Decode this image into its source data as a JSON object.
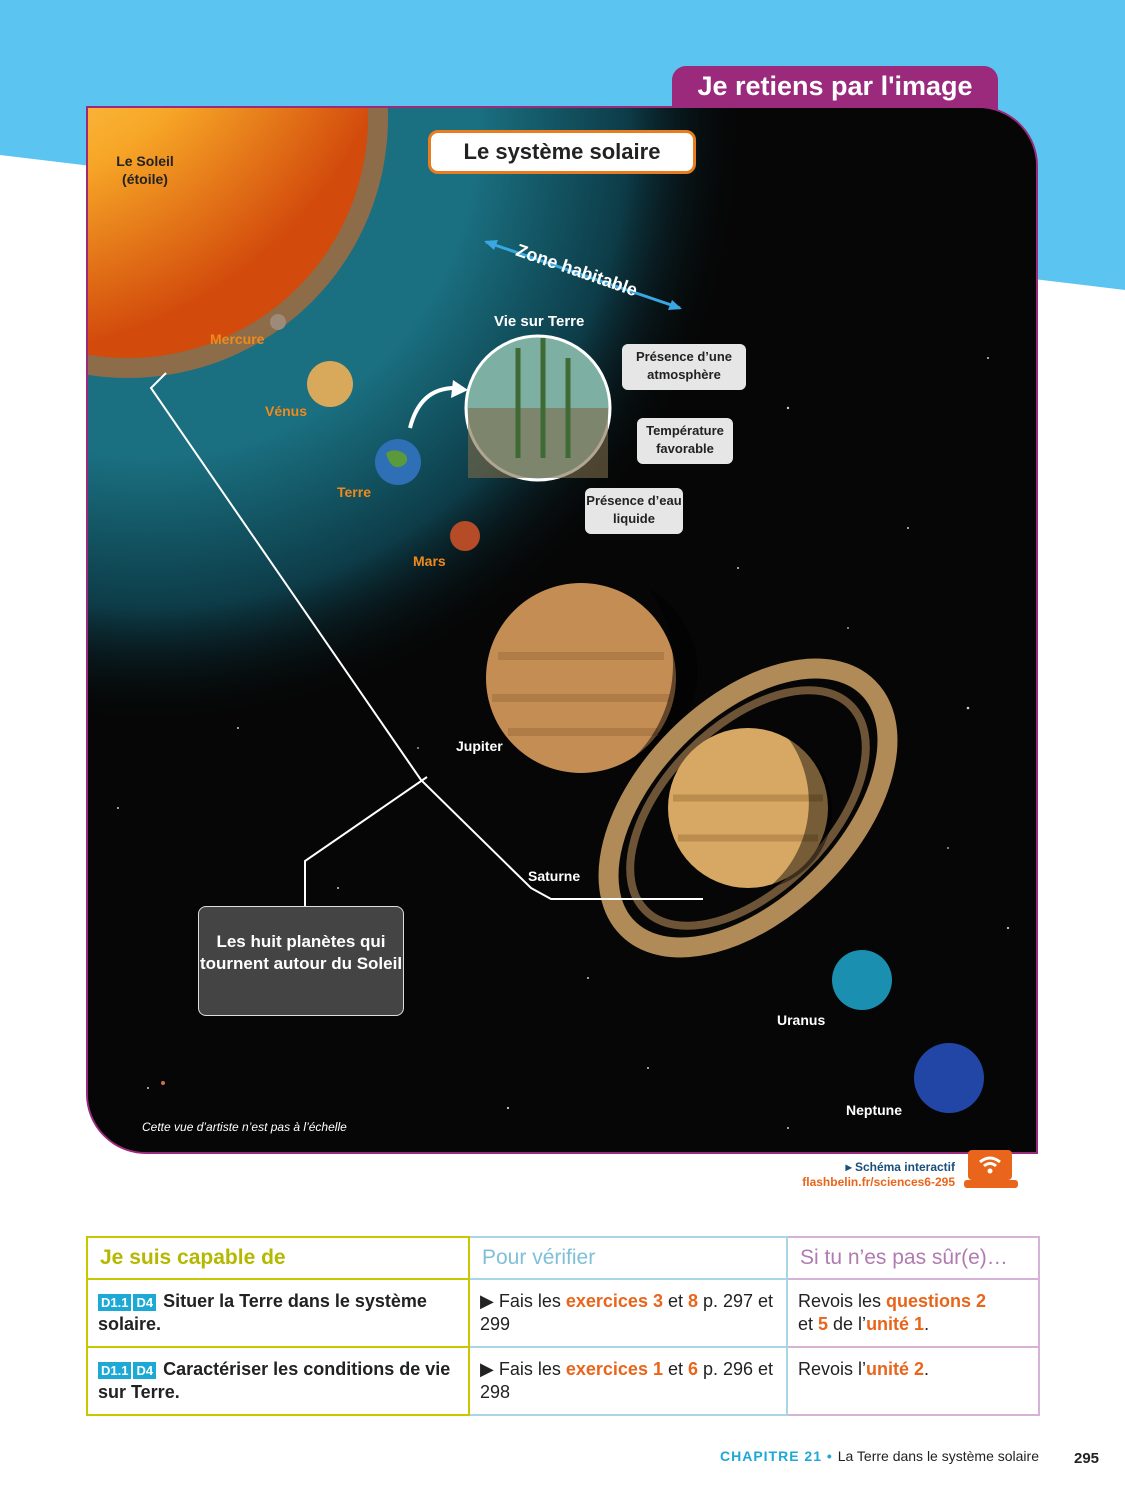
{
  "header": {
    "tab_title": "Je retiens par l'image"
  },
  "diagram": {
    "title": "Le système solaire",
    "sun_label": "Le Soleil",
    "sun_sublabel": "(étoile)",
    "zone_label": "Zone habitable",
    "life_title": "Vie sur Terre",
    "callouts": [
      "Présence d’une atmosphère",
      "Température favorable",
      "Présence d’eau liquide"
    ],
    "planets": [
      "Mercure",
      "Vénus",
      "Terre",
      "Mars",
      "Jupiter",
      "Saturne",
      "Uranus",
      "Neptune"
    ],
    "planets_box": "Les huit planètes qui tournent autour du Soleil",
    "scale_note": "Cette vue d’artiste n’est pas à l’échelle"
  },
  "interactive": {
    "label": "▸ Schéma interactif",
    "url": "flashbelin.fr/sciences6-295",
    "icon": "laptop-wifi-icon"
  },
  "skills_table": {
    "headers": [
      "Je suis capable de",
      "Pour vérifier",
      "Si tu n’es pas sûr(e)…"
    ],
    "rows": [
      {
        "tags": [
          "D1.1",
          "D4"
        ],
        "skill": "Situer la Terre dans le système solaire.",
        "verify_prefix": "▶ Fais les ",
        "verify_hl": "exercices 3",
        "verify_mid": " et ",
        "verify_hl2": "8",
        "verify_suffix": " p. 297 et 299",
        "review_prefix": "Revois les ",
        "review_hl": "questions 2",
        "review_mid": " et ",
        "review_hl2": "5",
        "review_mid2": " de l’",
        "review_hl3": "unité 1",
        "review_suffix": "."
      },
      {
        "tags": [
          "D1.1",
          "D4"
        ],
        "skill": "Caractériser les conditions de vie sur Terre.",
        "verify_prefix": "▶ Fais les ",
        "verify_hl": "exercices 1",
        "verify_mid": " et ",
        "verify_hl2": "6",
        "verify_suffix": " p. 296 et 298",
        "review_prefix": "Revois l’",
        "review_hl": "unité 2",
        "review_suffix": "."
      }
    ]
  },
  "footer": {
    "chapter": "CHAPITRE 21",
    "separator": " • ",
    "chapter_title": "La Terre dans le système solaire",
    "page_number": "295"
  },
  "colors": {
    "accent": "#9b2a7d",
    "orange": "#e8651b",
    "blue": "#1ca9d6",
    "sky": "#5bc4f0"
  }
}
